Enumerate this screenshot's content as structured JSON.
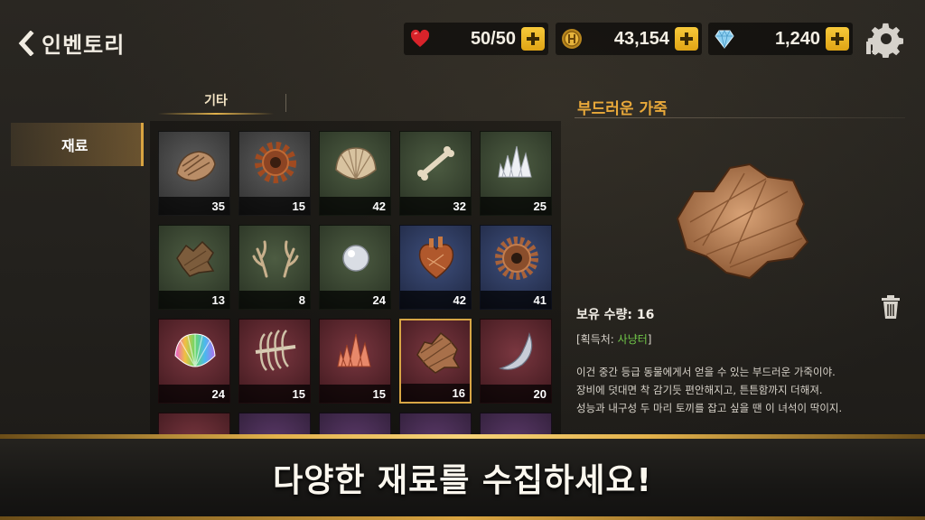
{
  "header": {
    "back_label": "인벤토리",
    "resources": [
      {
        "name": "health",
        "icon": "heart-icon",
        "value": "50/50"
      },
      {
        "name": "gold",
        "icon": "coin-icon",
        "value": "43,154"
      },
      {
        "name": "gems",
        "icon": "diamond-icon",
        "value": "1,240"
      }
    ]
  },
  "sidebar": {
    "category": "재료"
  },
  "tabs": [
    {
      "label": "기타",
      "active": true
    }
  ],
  "grid": {
    "items": [
      {
        "icon": "shell-scrap-icon",
        "qty": "35",
        "bg": "gray"
      },
      {
        "icon": "rusty-gear-icon",
        "qty": "15",
        "bg": "gray"
      },
      {
        "icon": "clam-shell-icon",
        "qty": "42",
        "bg": "green"
      },
      {
        "icon": "bone-icon",
        "qty": "32",
        "bg": "green"
      },
      {
        "icon": "white-crystal-icon",
        "qty": "25",
        "bg": "green"
      },
      {
        "icon": "hide-scrap-icon",
        "qty": "13",
        "bg": "green"
      },
      {
        "icon": "antler-icon",
        "qty": "8",
        "bg": "green"
      },
      {
        "icon": "pearl-icon",
        "qty": "24",
        "bg": "green"
      },
      {
        "icon": "heart-organ-icon",
        "qty": "42",
        "bg": "blue"
      },
      {
        "icon": "bronze-gear-icon",
        "qty": "41",
        "bg": "blue"
      },
      {
        "icon": "rainbow-shell-icon",
        "qty": "24",
        "bg": "red"
      },
      {
        "icon": "ribcage-icon",
        "qty": "15",
        "bg": "red"
      },
      {
        "icon": "red-crystal-icon",
        "qty": "15",
        "bg": "red"
      },
      {
        "icon": "soft-leather-icon",
        "qty": "16",
        "bg": "red",
        "selected": true
      },
      {
        "icon": "fang-icon",
        "qty": "20",
        "bg": "red"
      }
    ]
  },
  "detail": {
    "title": "부드러운 가죽",
    "owned": "보유 수량: 16",
    "source_prefix": "[획득처: ",
    "source_place": "사냥터",
    "source_suffix": "]",
    "desc_lines": [
      "이건 중간 등급 동물에게서 얻을 수 있는 부드러운 가죽이야.",
      "장비에 덧대면 착 감기듯 편안해지고, 튼튼함까지 더해져.",
      "성능과 내구성 두 마리 토끼를 잡고 싶을 땐 이 녀석이 딱이지."
    ]
  },
  "banner": {
    "text": "다양한 재료를 수집하세요!"
  },
  "colors": {
    "accent": "#d9a441",
    "title": "#e9a93a",
    "source_green": "#72c94a"
  }
}
